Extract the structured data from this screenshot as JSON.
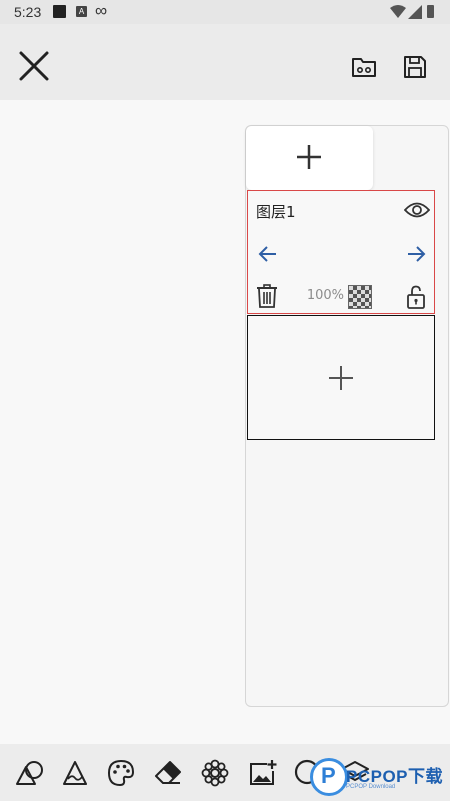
{
  "status_bar": {
    "time": "5:23",
    "app_icon_letter": "A",
    "infinity": "∞"
  },
  "toolbar": {
    "close_icon": "close-icon",
    "folder_icon": "folder-icon",
    "save_icon": "save-icon"
  },
  "layers_panel": {
    "add_button_icon": "plus-icon",
    "layers": [
      {
        "name": "图层1",
        "opacity": "100%",
        "visible": true,
        "locked": false,
        "selected": true
      }
    ],
    "new_layer_icon": "plus-icon"
  },
  "colors": {
    "selection_border": "#d94848",
    "arrow_color": "#2f5fa5",
    "icon_color": "#333333"
  },
  "bottom_tools": [
    {
      "icon": "shapes-icon"
    },
    {
      "icon": "brush-icon"
    },
    {
      "icon": "palette-icon"
    },
    {
      "icon": "eraser-icon"
    },
    {
      "icon": "flower-icon"
    },
    {
      "icon": "add-image-icon"
    },
    {
      "icon": "bubble-icon"
    },
    {
      "icon": "layers-icon"
    }
  ],
  "watermark": {
    "logo_letter": "P",
    "brand": "PCPOP下载",
    "sub": "PCPOP Download"
  }
}
